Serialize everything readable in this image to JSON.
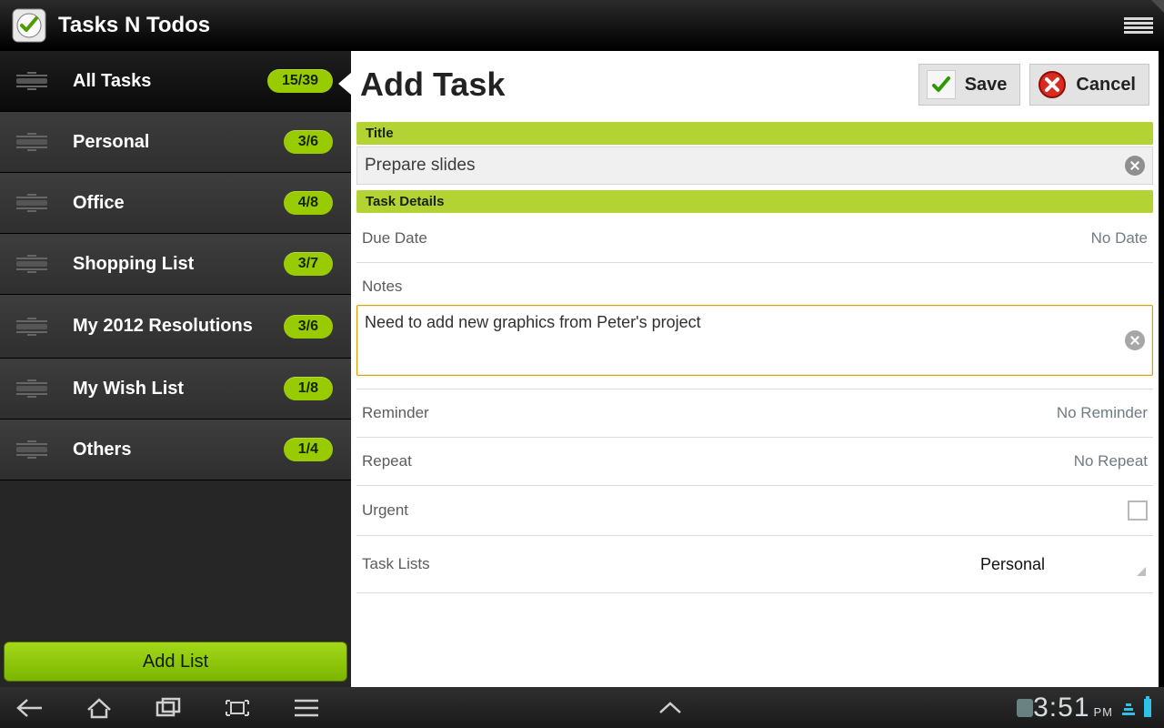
{
  "app": {
    "title": "Tasks N Todos"
  },
  "sidebar": {
    "items": [
      {
        "label": "All Tasks",
        "count": "15/39",
        "active": true
      },
      {
        "label": "Personal",
        "count": "3/6"
      },
      {
        "label": "Office",
        "count": "4/8"
      },
      {
        "label": "Shopping List",
        "count": "3/7"
      },
      {
        "label": "My 2012 Resolutions",
        "count": "3/6"
      },
      {
        "label": "My Wish List",
        "count": "1/8"
      },
      {
        "label": "Others",
        "count": "1/4"
      }
    ],
    "add_list_label": "Add List"
  },
  "form": {
    "heading": "Add Task",
    "save_label": "Save",
    "cancel_label": "Cancel",
    "section_title": "Title",
    "title_value": "Prepare slides",
    "section_details": "Task Details",
    "due_date": {
      "label": "Due Date",
      "value": "No Date"
    },
    "notes": {
      "label": "Notes",
      "value": "Need to add new graphics from Peter's project"
    },
    "reminder": {
      "label": "Reminder",
      "value": "No Reminder"
    },
    "repeat": {
      "label": "Repeat",
      "value": "No Repeat"
    },
    "urgent": {
      "label": "Urgent",
      "checked": false
    },
    "task_lists": {
      "label": "Task Lists",
      "value": "Personal"
    }
  },
  "system": {
    "time": "3:51",
    "meridiem": "PM"
  }
}
